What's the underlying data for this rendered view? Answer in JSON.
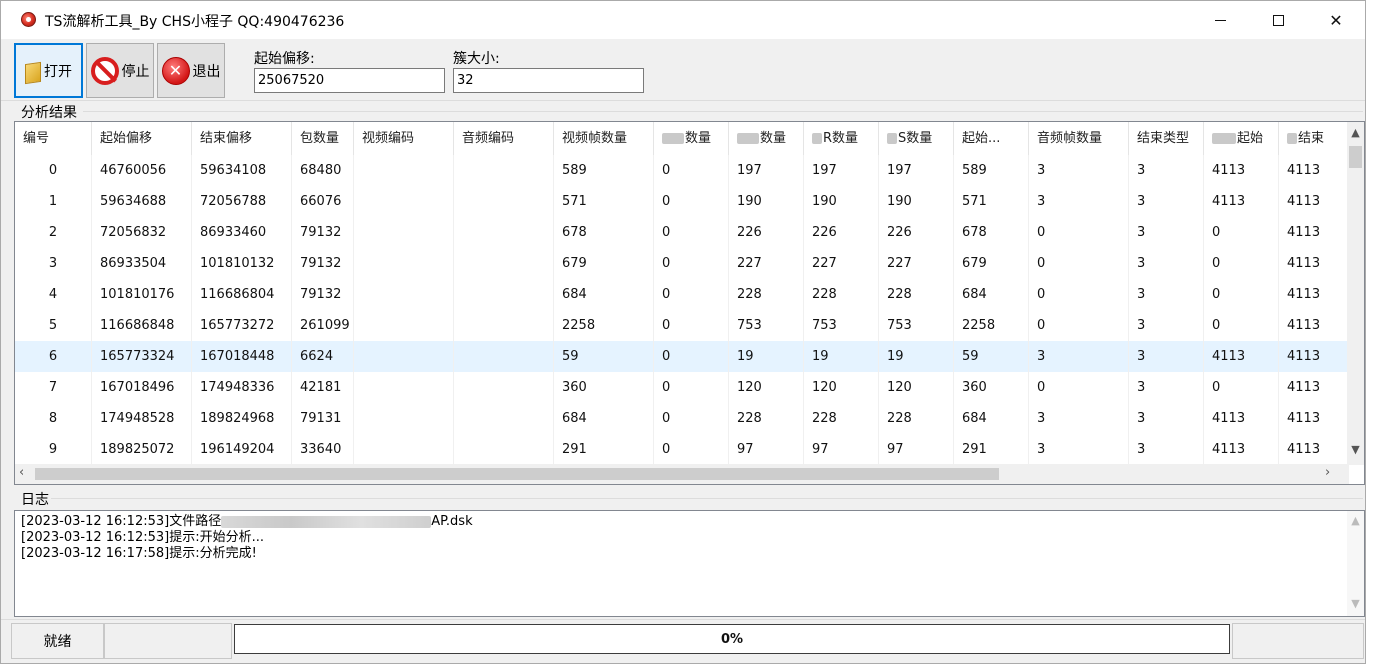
{
  "window": {
    "title": "TS流解析工具_By CHS小程子   QQ:490476236",
    "minimize": "minimize",
    "maximize": "maximize",
    "close": "✕"
  },
  "toolbar": {
    "open_label": "打开",
    "stop_label": "停止",
    "exit_label": "退出",
    "offset_label": "起始偏移:",
    "offset_value": "25067520",
    "cluster_label": "簇大小:",
    "cluster_value": "32"
  },
  "analysis": {
    "group_label": "分析结果",
    "columns": [
      "编号",
      "起始偏移",
      "结束偏移",
      "包数量",
      "视频编码",
      "音频编码",
      "视频帧数量",
      "数量",
      "数量",
      "R数量",
      "S数量",
      "起始...",
      "音频帧数量",
      "结束类型",
      "起始",
      "结束"
    ],
    "rows": [
      [
        "0",
        "46760056",
        "59634108",
        "68480",
        "",
        "",
        "589",
        "0",
        "197",
        "197",
        "197",
        "589",
        "3",
        "3",
        "4113",
        "4113"
      ],
      [
        "1",
        "59634688",
        "72056788",
        "66076",
        "",
        "",
        "571",
        "0",
        "190",
        "190",
        "190",
        "571",
        "3",
        "3",
        "4113",
        "4113"
      ],
      [
        "2",
        "72056832",
        "86933460",
        "79132",
        "",
        "",
        "678",
        "0",
        "226",
        "226",
        "226",
        "678",
        "0",
        "3",
        "0",
        "4113"
      ],
      [
        "3",
        "86933504",
        "101810132",
        "79132",
        "",
        "",
        "679",
        "0",
        "227",
        "227",
        "227",
        "679",
        "0",
        "3",
        "0",
        "4113"
      ],
      [
        "4",
        "101810176",
        "116686804",
        "79132",
        "",
        "",
        "684",
        "0",
        "228",
        "228",
        "228",
        "684",
        "0",
        "3",
        "0",
        "4113"
      ],
      [
        "5",
        "116686848",
        "165773272",
        "261099",
        "",
        "",
        "2258",
        "0",
        "753",
        "753",
        "753",
        "2258",
        "0",
        "3",
        "0",
        "4113"
      ],
      [
        "6",
        "165773324",
        "167018448",
        "6624",
        "",
        "",
        "59",
        "0",
        "19",
        "19",
        "19",
        "59",
        "3",
        "3",
        "4113",
        "4113"
      ],
      [
        "7",
        "167018496",
        "174948336",
        "42181",
        "",
        "",
        "360",
        "0",
        "120",
        "120",
        "120",
        "360",
        "0",
        "3",
        "0",
        "4113"
      ],
      [
        "8",
        "174948528",
        "189824968",
        "79131",
        "",
        "",
        "684",
        "0",
        "228",
        "228",
        "228",
        "684",
        "3",
        "3",
        "4113",
        "4113"
      ],
      [
        "9",
        "189825072",
        "196149204",
        "33640",
        "",
        "",
        "291",
        "0",
        "97",
        "97",
        "97",
        "291",
        "3",
        "3",
        "4113",
        "4113"
      ]
    ],
    "selected_row": 6
  },
  "log": {
    "group_label": "日志",
    "lines": [
      {
        "prefix": "[2023-03-12 16:12:53]文件路径",
        "suffix": "AP.dsk"
      },
      {
        "prefix": "[2023-03-12 16:12:53]提示:开始分析...",
        "suffix": ""
      },
      {
        "prefix": "[2023-03-12 16:17:58]提示:分析完成!",
        "suffix": ""
      }
    ]
  },
  "status": {
    "ready": "就绪",
    "progress_text": "0%",
    "progress_value": 0
  },
  "icons": {
    "app": "app-logo-icon",
    "open": "folder-icon",
    "stop": "stop-icon",
    "exit": "exit-icon"
  }
}
